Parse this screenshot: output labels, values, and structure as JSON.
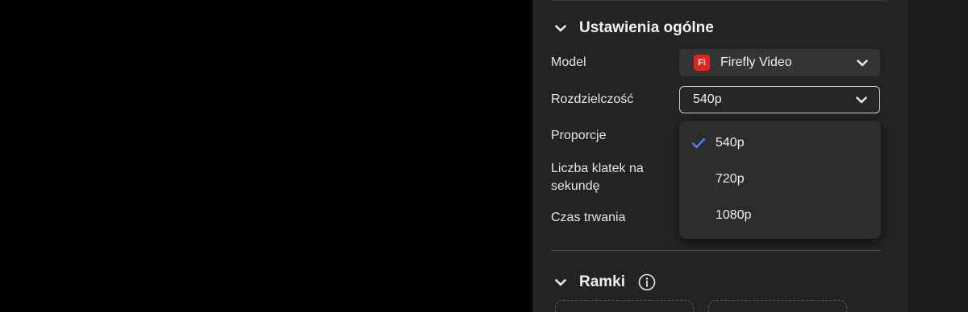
{
  "general_settings": {
    "title": "Ustawienia ogólne",
    "model": {
      "label": "Model",
      "value": "Firefly Video",
      "logo_text": "Fi"
    },
    "resolution": {
      "label": "Rozdzielczość",
      "value": "540p",
      "options": [
        {
          "label": "540p",
          "selected": true
        },
        {
          "label": "720p",
          "selected": false
        },
        {
          "label": "1080p",
          "selected": false
        }
      ]
    },
    "aspect_ratio": {
      "label": "Proporcje"
    },
    "frame_rate": {
      "label": "Liczba klatek na sekundę"
    },
    "duration": {
      "label": "Czas trwania"
    }
  },
  "frames": {
    "title": "Ramki"
  },
  "icons": {
    "section_toggle": "chevron-down-icon",
    "dropdown_caret": "chevron-down-icon",
    "selected_mark": "checkmark-icon",
    "info": "info-icon"
  },
  "colors": {
    "background": "#000000",
    "panel": "#232323",
    "checkmark": "#4a7cff",
    "firefly_brand": "#e1251b"
  }
}
